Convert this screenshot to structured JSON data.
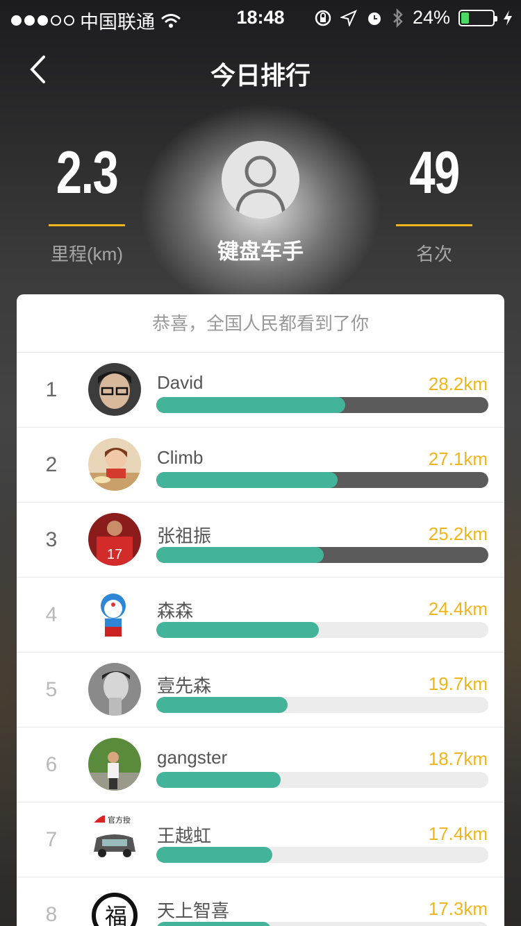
{
  "status_bar": {
    "carrier": "中国联通",
    "time": "18:48",
    "battery": "24%",
    "battery_level": 0.24
  },
  "nav": {
    "title": "今日排行"
  },
  "header": {
    "distance_value": "2.3",
    "distance_label": "里程(km)",
    "user_name": "键盘车手",
    "rank_value": "49",
    "rank_label": "名次"
  },
  "banner": "恭喜，全国人民都看到了你",
  "colors": {
    "accent": "#f0b51a",
    "progress": "#43b49a",
    "track_top": "#5b5b5b",
    "track": "#ececec"
  },
  "rankings": [
    {
      "rank": "1",
      "name": "David",
      "distance": "28.2km",
      "progress": 0.57,
      "avatar": "man-glasses"
    },
    {
      "rank": "2",
      "name": "Climb",
      "distance": "27.1km",
      "progress": 0.545,
      "avatar": "child"
    },
    {
      "rank": "3",
      "name": "张祖振",
      "distance": "25.2km",
      "progress": 0.505,
      "avatar": "football"
    },
    {
      "rank": "4",
      "name": "森森",
      "distance": "24.4km",
      "progress": 0.49,
      "avatar": "cartoon"
    },
    {
      "rank": "5",
      "name": "壹先森",
      "distance": "19.7km",
      "progress": 0.395,
      "avatar": "bw-portrait"
    },
    {
      "rank": "6",
      "name": "gangster",
      "distance": "18.7km",
      "progress": 0.375,
      "avatar": "outdoor"
    },
    {
      "rank": "7",
      "name": "王越虹",
      "distance": "17.4km",
      "progress": 0.35,
      "avatar": "car",
      "avatar_text": "官方授"
    },
    {
      "rank": "8",
      "name": "天上智喜",
      "distance": "17.3km",
      "progress": 0.345,
      "avatar": "calligraphy",
      "avatar_text": "福"
    }
  ]
}
